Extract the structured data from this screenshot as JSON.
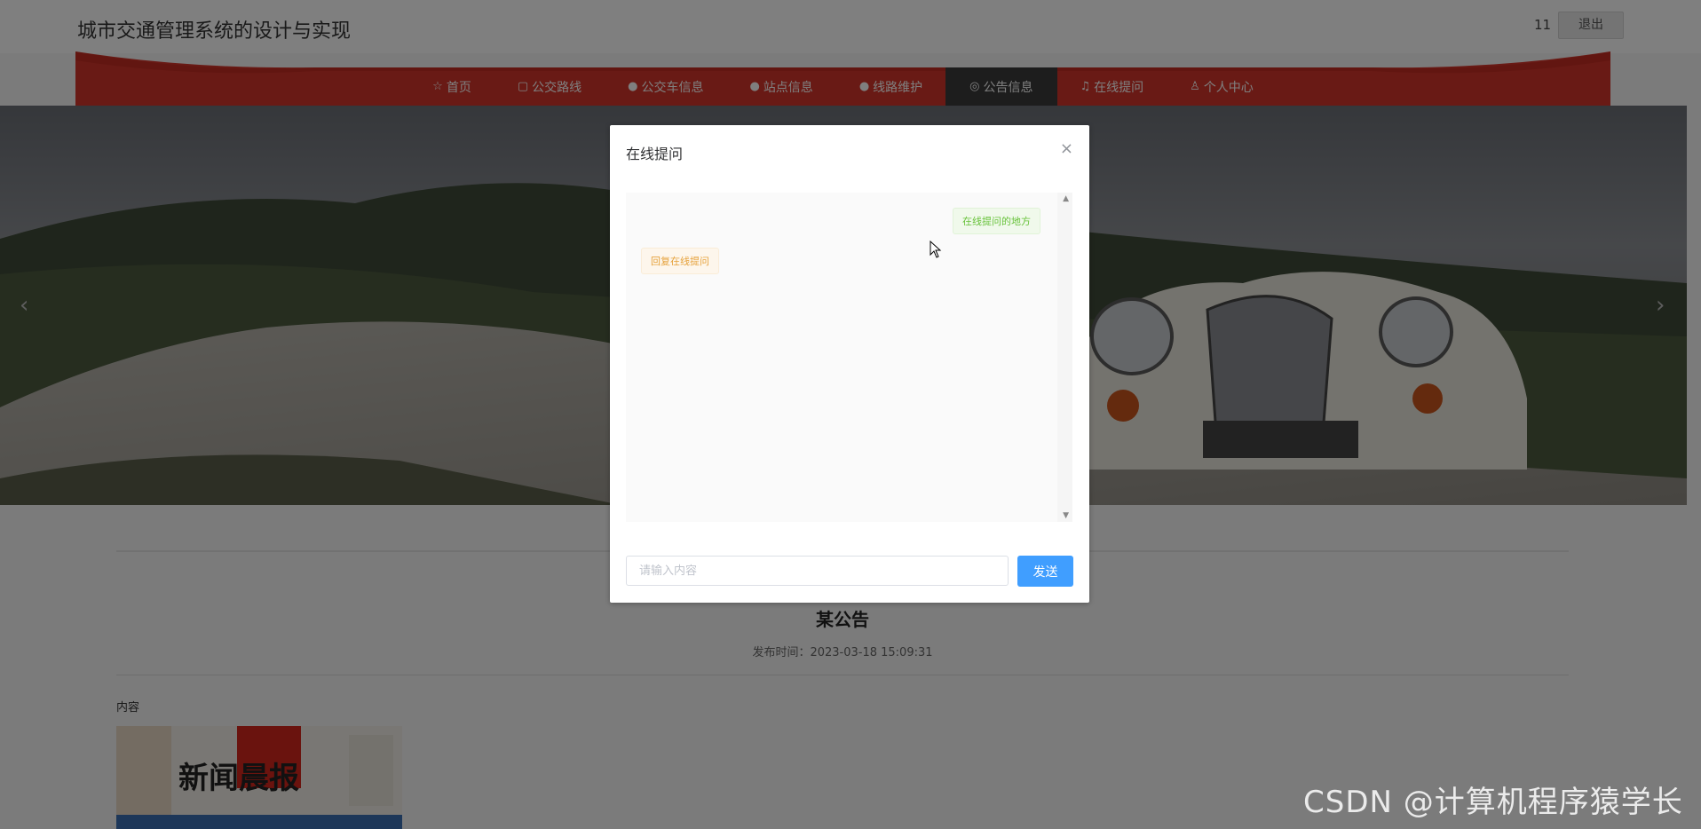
{
  "header": {
    "site_title": "城市交通管理系统的设计与实现",
    "user_name": "11",
    "logout_label": "退出"
  },
  "nav": {
    "items": [
      {
        "label": "首页",
        "icon": "star-icon"
      },
      {
        "label": "公交路线",
        "icon": "bag-icon"
      },
      {
        "label": "公交车信息",
        "icon": "question-circle-icon"
      },
      {
        "label": "站点信息",
        "icon": "question-circle-icon"
      },
      {
        "label": "线路维护",
        "icon": "info-circle-icon"
      },
      {
        "label": "公告信息",
        "icon": "settings-circle-icon",
        "active": true
      },
      {
        "label": "在线提问",
        "icon": "headset-icon"
      },
      {
        "label": "个人中心",
        "icon": "user-icon"
      }
    ],
    "accent_color": "#c6271b"
  },
  "notice": {
    "title": "某公告",
    "publish_time": "发布时间：2023-03-18 15:09:31",
    "content_label": "内容",
    "newspaper_text": "新闻晨报"
  },
  "dialog": {
    "title": "在线提问",
    "messages": {
      "question": "在线提问的地方",
      "reply": "回复在线提问"
    },
    "input_placeholder": "请输入内容",
    "send_label": "发送",
    "send_color": "#409eff"
  },
  "watermark": "CSDN @计算机程序猿学长"
}
